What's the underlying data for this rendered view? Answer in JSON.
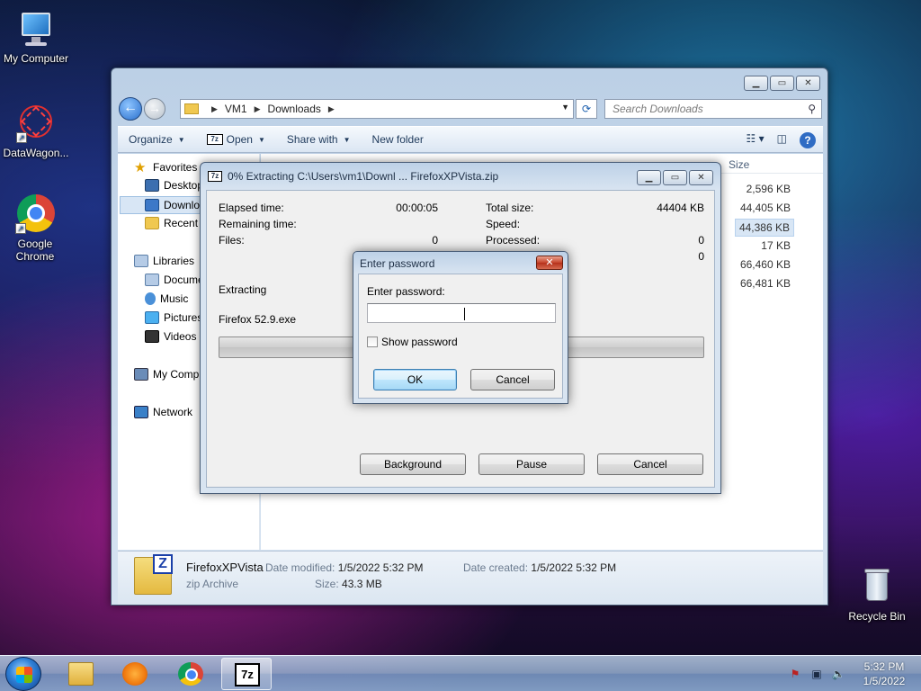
{
  "desktop": {
    "icons": [
      {
        "label": "My Computer"
      },
      {
        "label": "DataWagon..."
      },
      {
        "label": "Google Chrome"
      },
      {
        "label": "Recycle Bin"
      }
    ]
  },
  "explorer": {
    "breadcrumb": [
      "VM1",
      "Downloads"
    ],
    "search_placeholder": "Search Downloads",
    "toolbar": {
      "organize": "Organize",
      "open": "Open",
      "share_with": "Share with",
      "new_folder": "New folder"
    },
    "nav": {
      "favorites": "Favorites",
      "desktop": "Desktop",
      "downloads": "Downloads",
      "recent": "Recent Places",
      "libraries": "Libraries",
      "documents": "Documents",
      "music": "Music",
      "pictures": "Pictures",
      "videos": "Videos",
      "my_computer": "My Computer",
      "network": "Network"
    },
    "column_size": "Size",
    "sizes": [
      "2,596 KB",
      "44,405 KB",
      "44,386 KB",
      "17 KB",
      "66,460 KB",
      "66,481 KB"
    ],
    "details": {
      "name": "FirefoxXPVista",
      "type": "zip Archive",
      "date_modified_label": "Date modified:",
      "date_modified": "1/5/2022 5:32 PM",
      "date_created_label": "Date created:",
      "date_created": "1/5/2022 5:32 PM",
      "size_label": "Size:",
      "size": "43.3 MB"
    }
  },
  "extract_dialog": {
    "title": "0% Extracting C:\\Users\\vm1\\Downl ... FirefoxXPVista.zip",
    "elapsed_label": "Elapsed time:",
    "elapsed": "00:00:05",
    "remaining_label": "Remaining time:",
    "files_label": "Files:",
    "files": "0",
    "total_size_label": "Total size:",
    "total_size": "44404 KB",
    "speed_label": "Speed:",
    "processed_label": "Processed:",
    "processed": "0",
    "extra_value": "0",
    "status": "Extracting",
    "current_file": "Firefox 52.9.exe",
    "progress": 0,
    "buttons": {
      "background": "Background",
      "pause": "Pause",
      "cancel": "Cancel"
    }
  },
  "password_dialog": {
    "title": "Enter password",
    "prompt": "Enter password:",
    "value": "",
    "show_password": "Show password",
    "ok": "OK",
    "cancel": "Cancel"
  },
  "taskbar": {
    "time": "5:32 PM",
    "date": "1/5/2022",
    "apps": [
      "windows-explorer",
      "windows-media-player",
      "google-chrome",
      "7-zip"
    ]
  }
}
